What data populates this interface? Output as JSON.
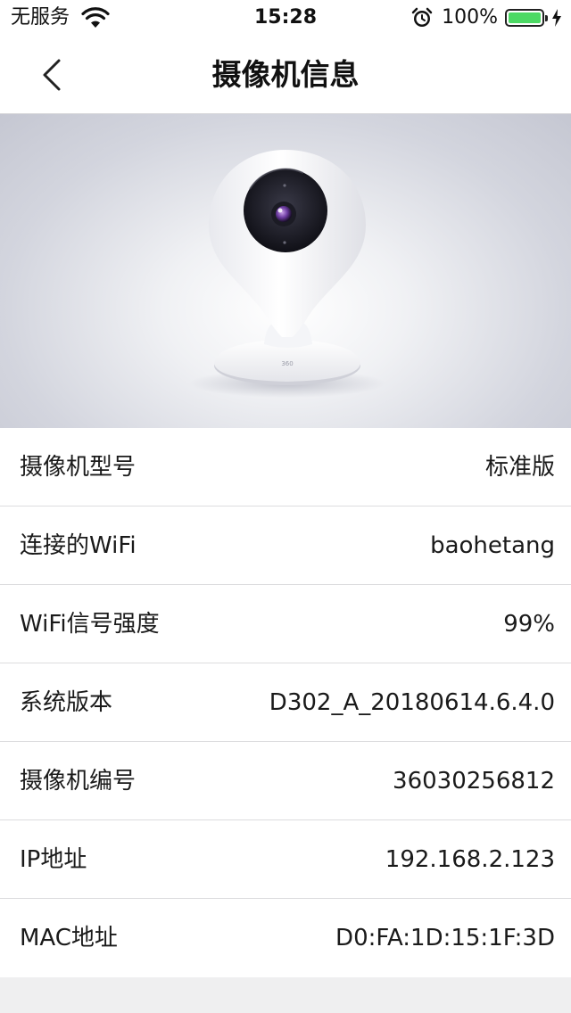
{
  "status_bar": {
    "carrier": "无服务",
    "time": "15:28",
    "battery_percent": "100%",
    "battery_level": 1.0,
    "icons": [
      "wifi-icon",
      "alarm-icon",
      "battery-icon",
      "charging-bolt-icon"
    ],
    "battery_color": "#4cd964"
  },
  "nav": {
    "title": "摄像机信息",
    "back_icon": "chevron-left-icon"
  },
  "hero": {
    "image": "camera-product-photo",
    "brand_mark": "360"
  },
  "info_rows": [
    {
      "label": "摄像机型号",
      "value": "标准版"
    },
    {
      "label": "连接的WiFi",
      "value": "baohetang"
    },
    {
      "label": "WiFi信号强度",
      "value": "99%"
    },
    {
      "label": "系统版本",
      "value": "D302_A_20180614.6.4.0"
    },
    {
      "label": "摄像机编号",
      "value": "36030256812"
    },
    {
      "label": "IP地址",
      "value": "192.168.2.123"
    },
    {
      "label": "MAC地址",
      "value": "D0:FA:1D:15:1F:3D"
    }
  ],
  "colors": {
    "page_background": "#efeff0",
    "row_background": "#ffffff",
    "divider": "#dcdcde",
    "hero_background": "#d3d5de"
  }
}
